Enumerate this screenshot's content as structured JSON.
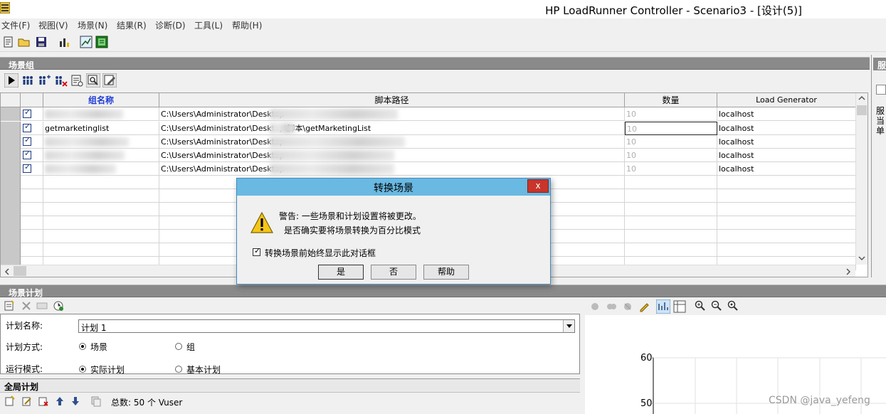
{
  "window": {
    "title": "HP LoadRunner Controller - Scenario3 - [设计(5)]"
  },
  "menu": [
    "文件(F)",
    "视图(V)",
    "场景(N)",
    "结果(R)",
    "诊断(D)",
    "工具(L)",
    "帮助(H)"
  ],
  "toolbar_icons": [
    "new-scenario-icon",
    "open-icon",
    "save-icon",
    "chart-icon",
    "design-icon",
    "run-icon"
  ],
  "scenario_group": {
    "header": "场景组",
    "toolbar_icons": [
      "play-icon",
      "vusers-icon",
      "add-group-icon",
      "remove-group-icon",
      "details-icon",
      "view-script-icon",
      "edit-icon"
    ],
    "columns": [
      "组名称",
      "脚本路径",
      "数量",
      "Load Generator"
    ],
    "rows": [
      {
        "checked": true,
        "name": "",
        "path": "C:\\Users\\Administrator\\Desktop",
        "qty": "10",
        "lg": "localhost"
      },
      {
        "checked": true,
        "name": "getmarketinglist",
        "path": "C:\\Users\\Administrator\\Desktop\\脚本\\getMarketingList",
        "qty": "10",
        "lg": "localhost"
      },
      {
        "checked": true,
        "name": "",
        "path": "C:\\Users\\Administrator\\Desktop",
        "qty": "10",
        "lg": "localhost"
      },
      {
        "checked": true,
        "name": "",
        "path": "C:\\Users\\Administrator\\Desktop",
        "qty": "10",
        "lg": "localhost"
      },
      {
        "checked": true,
        "name": "",
        "path": "C:\\Users\\Administrator\\Desktop",
        "qty": "10",
        "lg": "localhost"
      }
    ]
  },
  "right_panel": {
    "label_lines": [
      "服",
      "当",
      "单"
    ]
  },
  "schedule": {
    "header": "场景计划",
    "name_label": "计划名称:",
    "name_value": "计划 1",
    "mode_label": "计划方式:",
    "mode_option_scenario": "场景",
    "mode_option_group": "组",
    "run_label": "运行模式:",
    "run_option_real": "实际计划",
    "run_option_basic": "基本计划",
    "global_header": "全局计划",
    "total_text": "总数: 50 个 Vuser"
  },
  "chart": {
    "y_ticks": [
      "60",
      "50"
    ]
  },
  "dialog": {
    "title": "转换场景",
    "close": "x",
    "warning_line1": "警告: 一些场景和计划设置将被更改。",
    "warning_line2": "是否确实要将场景转换为百分比模式",
    "checkbox_label": "转换场景前始终显示此对话框",
    "checkbox_checked": true,
    "btn_yes": "是",
    "btn_no": "否",
    "btn_help": "帮助"
  },
  "watermark": "CSDN @java_yefeng",
  "colors": {
    "panel_header": "#8a8a8a",
    "dialog_title": "#69b9e2",
    "close_button": "#c8352a",
    "check": "#1d3b7e"
  }
}
